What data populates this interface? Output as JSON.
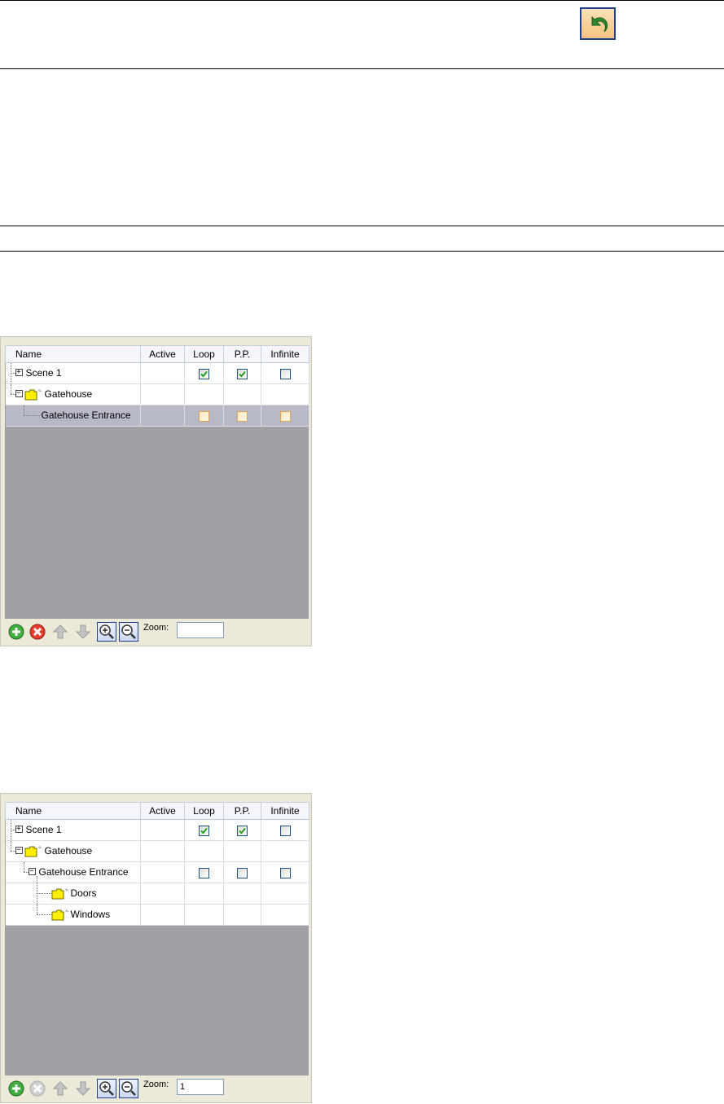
{
  "header_toolbar": {
    "undo_icon": "undo-arrow-icon"
  },
  "columns": [
    "Name",
    "Active",
    "Loop",
    "P.P.",
    "Infinite"
  ],
  "panel1": {
    "rows": [
      {
        "name": "Scene 1",
        "expander": "+",
        "folder": false,
        "loop": true,
        "pp": true,
        "infinite": false,
        "selected": false
      },
      {
        "name": "Gatehouse",
        "expander": "−",
        "folder": true,
        "loop": null,
        "pp": null,
        "infinite": null,
        "selected": false
      },
      {
        "name": "Gatehouse Entrance",
        "expander": null,
        "folder": false,
        "loop": false,
        "pp": false,
        "infinite": false,
        "selected": true
      }
    ],
    "zoom_label": "Zoom:",
    "zoom_value": ""
  },
  "panel2": {
    "rows": [
      {
        "name": "Scene 1",
        "expander": "+",
        "folder": false,
        "loop": true,
        "pp": true,
        "infinite": false
      },
      {
        "name": "Gatehouse",
        "expander": "−",
        "folder": true,
        "loop": null,
        "pp": null,
        "infinite": null
      },
      {
        "name": "Gatehouse Entrance",
        "expander": "−",
        "folder": false,
        "loop": false,
        "pp": false,
        "infinite": false
      },
      {
        "name": "Doors",
        "expander": null,
        "folder": true,
        "loop": null,
        "pp": null,
        "infinite": null
      },
      {
        "name": "Windows",
        "expander": null,
        "folder": true,
        "loop": null,
        "pp": null,
        "infinite": null
      }
    ],
    "zoom_label": "Zoom:",
    "zoom_value": "1"
  },
  "colors": {
    "grid_background": "#a0a0a4",
    "panel_background": "#ece9d8",
    "selected_row": "#b7b8c8",
    "check_green": "#21a121"
  }
}
